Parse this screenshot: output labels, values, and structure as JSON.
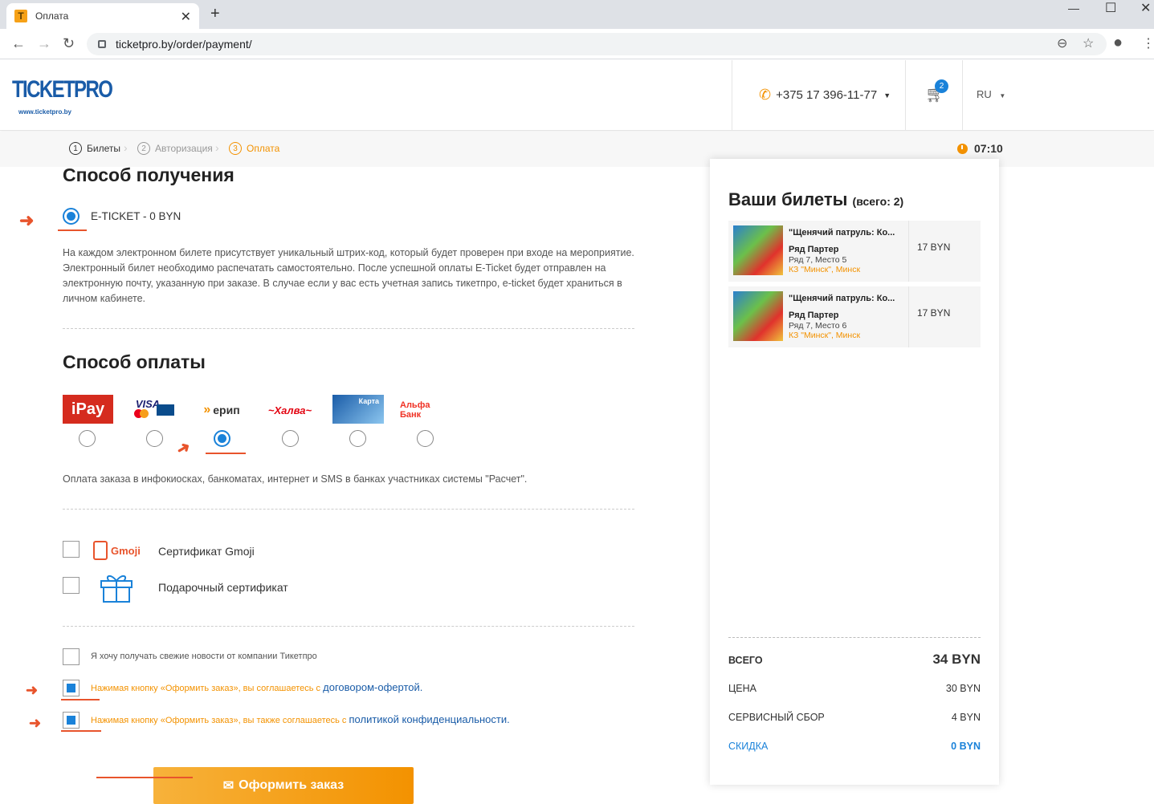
{
  "browser": {
    "tab_title": "Оплата",
    "favicon_letter": "T",
    "url": "ticketpro.by/order/payment/"
  },
  "header": {
    "logo_text": "TICKETPRO",
    "logo_sub": "www.ticketpro.by",
    "phone": "+375 17 396-11-77",
    "cart_count": "2",
    "language": "RU"
  },
  "steps": [
    {
      "num": "1",
      "label": "Билеты"
    },
    {
      "num": "2",
      "label": "Авторизация"
    },
    {
      "num": "3",
      "label": "Оплата"
    }
  ],
  "timer": "07:10",
  "delivery": {
    "title": "Способ получения",
    "option_label": "E-TICKET - 0 BYN",
    "description": "На каждом электронном билете присутствует уникальный штрих-код, который будет проверен при входе на мероприятие. Электронный билет необходимо распечатать самостоятельно. После успешной оплаты E-Ticket будет отправлен на электронную почту, указанную при заказе. В случае если у вас есть учетная запись тикетпро, e-ticket будет храниться в личном кабинете."
  },
  "payment": {
    "title": "Способ оплаты",
    "methods": [
      {
        "name": "iPay",
        "color": "#d52b1e"
      },
      {
        "name": "VISA",
        "color": "#1a1f71"
      },
      {
        "name": "ерип",
        "color": "#f39200"
      },
      {
        "name": "~Халва~",
        "color": "#e30613"
      },
      {
        "name": "Карта",
        "color": "#1a5ca8"
      },
      {
        "name": "Альфа Банк",
        "color": "#ef3124"
      }
    ],
    "selected_index": 2,
    "description": "Оплата заказа в инфокиосках, банкоматах, интернет и SMS в банках участниках системы \"Расчет\"."
  },
  "certificates": {
    "gmoji_logo": "Gmoji",
    "gmoji_label": "Сертификат Gmoji",
    "gift_label": "Подарочный сертификат"
  },
  "consents": {
    "newsletter": "Я хочу получать свежие новости от компании Тикетпро",
    "offer_text": "Нажимая кнопку «Оформить заказ», вы соглашаетесь с",
    "offer_link": "договором-офертой",
    "privacy_text": "Нажимая кнопку «Оформить заказ», вы также соглашаетесь с",
    "privacy_link": "политикой конфиденциальности"
  },
  "order_button": "Оформить заказ",
  "cart_panel": {
    "title": "Ваши билеты",
    "count_label": "(всего: 2)",
    "tickets": [
      {
        "name": "\"Щенячий патруль: Ко...",
        "row_label": "Ряд Партер",
        "seat": "Ряд 7, Место 5",
        "venue": "КЗ \"Минск\", Минск",
        "price": "17 BYN"
      },
      {
        "name": "\"Щенячий патруль: Ко...",
        "row_label": "Ряд Партер",
        "seat": "Ряд 7, Место 6",
        "venue": "КЗ \"Минск\", Минск",
        "price": "17 BYN"
      }
    ],
    "total_label": "ВСЕГО",
    "total_value": "34 BYN",
    "price_label": "ЦЕНА",
    "price_value": "30 BYN",
    "fee_label": "СЕРВИСНЫЙ СБОР",
    "fee_value": "4 BYN",
    "discount_label": "СКИДКА",
    "discount_value": "0 BYN"
  }
}
